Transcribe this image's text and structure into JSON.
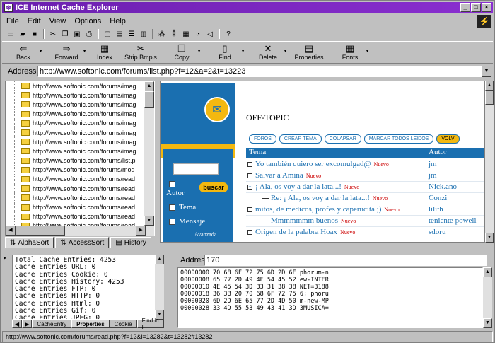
{
  "window": {
    "title": "ICE Internet Cache Explorer",
    "app_icon": "ice-icon",
    "brand_glyph": "⚡"
  },
  "title_controls": {
    "minimize": "_",
    "maximize": "□",
    "close": "×"
  },
  "menu": [
    "File",
    "Edit",
    "View",
    "Options",
    "Help"
  ],
  "toolbar": [
    {
      "label": "Back",
      "icon": "back-arrow-icon",
      "glyph": "⇐",
      "dropdown": true
    },
    {
      "label": "Forward",
      "icon": "forward-arrow-icon",
      "glyph": "⇒",
      "dropdown": true
    },
    {
      "label": "Index",
      "icon": "index-icon",
      "glyph": "▦",
      "dropdown": false
    },
    {
      "label": "Strip Bmp's",
      "icon": "scissors-icon",
      "glyph": "✂",
      "dropdown": false
    },
    {
      "label": "Copy",
      "icon": "copy-icon",
      "glyph": "❐",
      "dropdown": true
    },
    {
      "label": "Find",
      "icon": "find-icon",
      "glyph": "▯",
      "dropdown": true
    },
    {
      "label": "Delete",
      "icon": "delete-icon",
      "glyph": "✕",
      "dropdown": true
    },
    {
      "label": "Properties",
      "icon": "properties-icon",
      "glyph": "▤",
      "dropdown": false
    },
    {
      "label": "Fonts",
      "icon": "fonts-icon",
      "glyph": "▦",
      "dropdown": true
    }
  ],
  "address": {
    "label": "Address:",
    "value": "http://www.softonic.com/forums/list.php?f=12&a=2&t=13223"
  },
  "tree_items": [
    "http://www.softonic.com/forums/imag",
    "http://www.softonic.com/forums/imag",
    "http://www.softonic.com/forums/imag",
    "http://www.softonic.com/forums/imag",
    "http://www.softonic.com/forums/imag",
    "http://www.softonic.com/forums/imag",
    "http://www.softonic.com/forums/imag",
    "http://www.softonic.com/forums/imag",
    "http://www.softonic.com/forums/list.p",
    "http://www.softonic.com/forums/mod",
    "http://www.softonic.com/forums/read",
    "http://www.softonic.com/forums/read",
    "http://www.softonic.com/forums/read",
    "http://www.softonic.com/forums/read",
    "http://www.softonic.com/forums/read",
    "http://www.softonic.com/forums/read"
  ],
  "left_tabs": [
    "AlphaSort",
    "AccessSort",
    "History"
  ],
  "web": {
    "section_title": "OFF-TOPIC",
    "buttons": [
      "FOROS",
      "CREAR TEMA",
      "COLAPSAR",
      "MARCAR TODOS LEIDOS",
      "VOLV"
    ],
    "col_tema": "Tema",
    "col_autor": "Autor",
    "search_button": "buscar",
    "chk_autor": "Autor",
    "chk_tema": "Tema",
    "chk_mensaje": "Mensaje",
    "advanced": "Avanzada",
    "new_badge": "Nuevo",
    "rows": [
      {
        "title": "Yo también quiero ser excomulgad@",
        "author": "jm",
        "indent": 0,
        "marker": "box"
      },
      {
        "title": "Salvar a Amina",
        "author": "jm",
        "indent": 0,
        "marker": "box"
      },
      {
        "title": "¡ Ala, os voy a dar la lata...!",
        "author": "Nick.ano",
        "indent": 0,
        "marker": "plus"
      },
      {
        "title": "Re: ¡ Ala, os voy a dar la lata...!",
        "author": "Conzi",
        "indent": 1,
        "marker": "line"
      },
      {
        "title": "mitos, de medicos, profes y caperucita ;)",
        "author": "lilith",
        "indent": 0,
        "marker": "plus"
      },
      {
        "title": "Mmmmmmm buenos",
        "author": "teniente powell",
        "indent": 1,
        "marker": "line"
      },
      {
        "title": "Origen de la palabra Hoax",
        "author": "sdoru",
        "indent": 0,
        "marker": "box"
      }
    ]
  },
  "stats": [
    "Total Cache Entries: 4253",
    "Cache Entries URL: 0",
    "Cache Entries Cookie: 0",
    "Cache Entries History: 4253",
    "Cache Entries FTP: 0",
    "Cache Entries HTTP: 0",
    "Cache Entries Html: 0",
    "Cache Entries Gif: 0",
    "Cache Entries JPEG: 0"
  ],
  "bottom_tabs": [
    "CacheEntry",
    "Properties",
    "Cookie",
    "Find in F"
  ],
  "hex": {
    "label": "Address",
    "value": "170",
    "lines": [
      "00000000 70 68 6F 72 75 6D 2D 6E phorum-n",
      "00000008 65 77 2D 49 4E 54 45 52 ew-INTER",
      "00000010 4E 45 54 3D 33 31 38 38 NET=3188",
      "00000018 36 3B 20 70 68 6F 72 75 6; phoru",
      "00000020 6D 2D 6E 65 77 2D 4D 50 m-new-MP",
      "00000028 33 4D 55 53 49 43 41 3D 3MUSICA="
    ]
  },
  "status": "http://www.softonic.com/forums/read.php?f=12&i=13282&t=13282#13282"
}
